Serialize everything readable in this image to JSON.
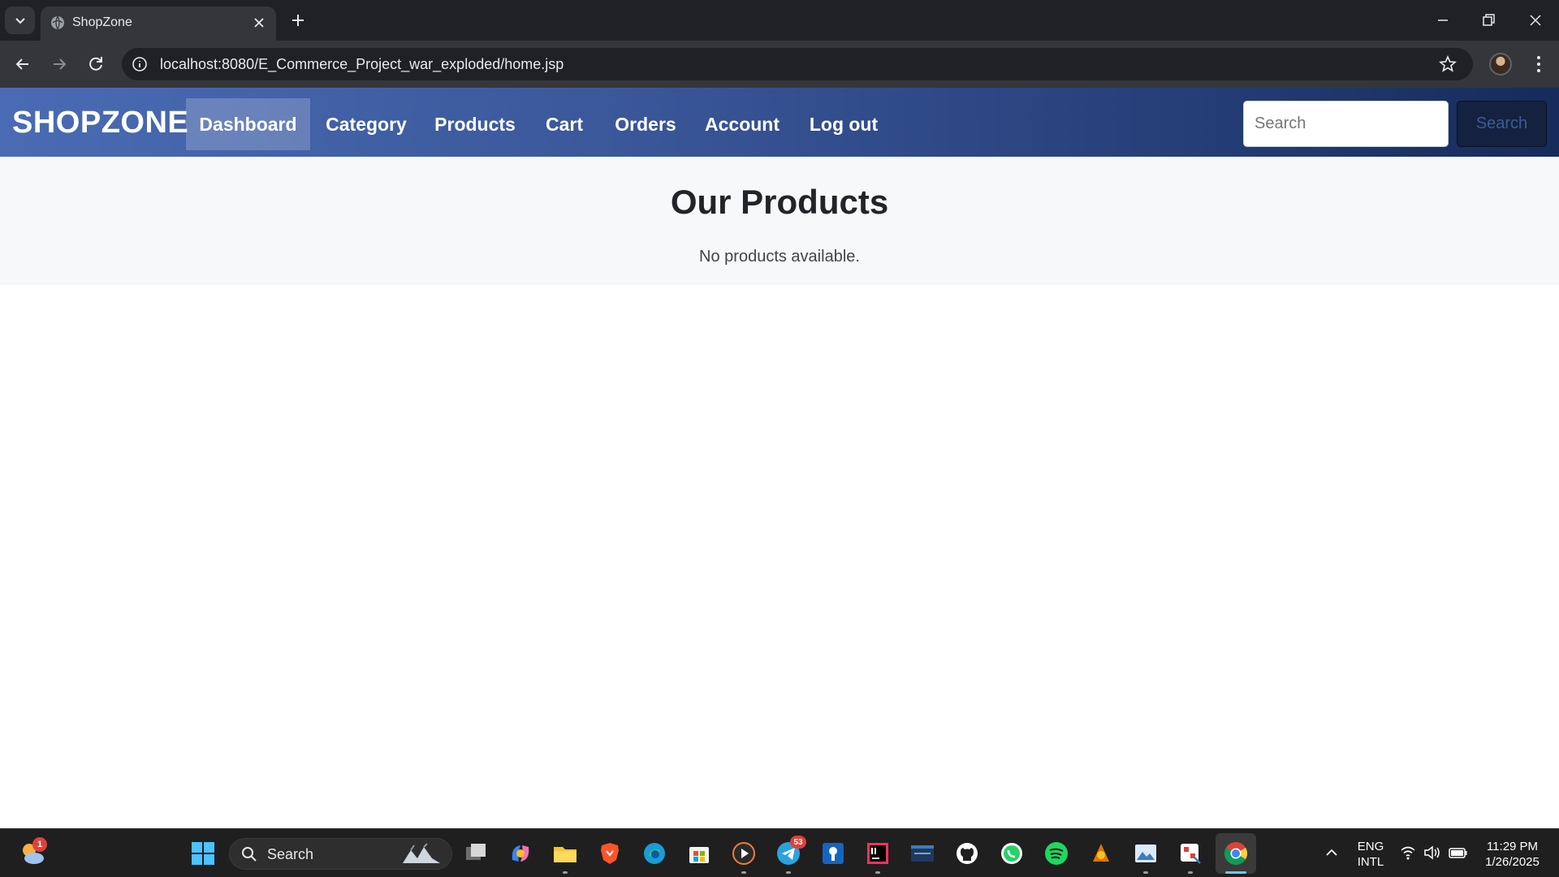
{
  "browser": {
    "tab_title": "ShopZone",
    "url": "localhost:8080/E_Commerce_Project_war_exploded/home.jsp"
  },
  "navbar": {
    "brand": "SHOPZONE",
    "links": [
      {
        "label": "Dashboard",
        "active": true
      },
      {
        "label": "Category",
        "active": false
      },
      {
        "label": "Products",
        "active": false
      },
      {
        "label": "Cart",
        "active": false
      },
      {
        "label": "Orders",
        "active": false
      },
      {
        "label": "Account",
        "active": false
      },
      {
        "label": "Log out",
        "active": false
      }
    ],
    "search": {
      "placeholder": "Search",
      "button_label": "Search"
    }
  },
  "main": {
    "title": "Our Products",
    "empty_message": "No products available."
  },
  "taskbar": {
    "weather_badge": "1",
    "search_label": "Search",
    "telegram_badge": "53",
    "apps": [
      "windows-start",
      "search",
      "task-view",
      "copilot",
      "file-explorer",
      "brave",
      "edge",
      "microsoft-store",
      "media-player",
      "telegram",
      "vpn",
      "intellij",
      "mysql",
      "github",
      "whatsapp",
      "spotify",
      "lumion",
      "photos",
      "snipping-tool",
      "chrome"
    ],
    "language": "ENG",
    "layout": "INTL",
    "time": "11:29 PM",
    "date": "1/26/2025"
  },
  "colors": {
    "nav_start": "#4a6bb4",
    "nav_end": "#162b5a",
    "search_button": "#14223f",
    "content_bg": "#f7f8fa"
  }
}
